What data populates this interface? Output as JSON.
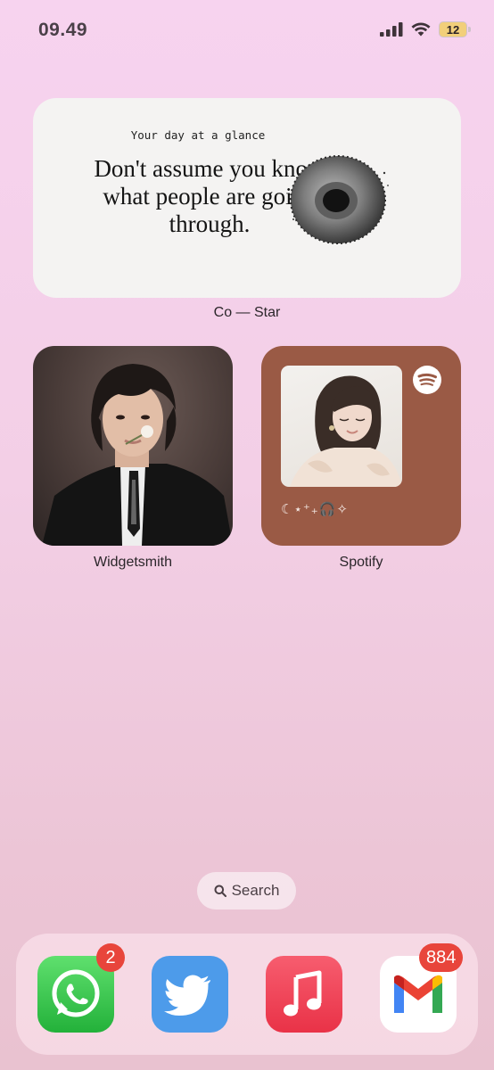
{
  "status_bar": {
    "time": "09.49",
    "battery": "12"
  },
  "costar_widget": {
    "kicker": "Your day at a glance",
    "quote": "Don't assume you know what people are going through.",
    "label": "Co — Star"
  },
  "widgets": {
    "widgetsmith_label": "Widgetsmith",
    "spotify_label": "Spotify",
    "spotify_caption": "☾⋆⁺₊🎧✧"
  },
  "search": {
    "label": "Search"
  },
  "dock": {
    "whatsapp_badge": "2",
    "gmail_badge": "884"
  },
  "colors": {
    "accent_badge": "#e8453b",
    "spotify_widget_bg": "#9a5a45",
    "wallpaper_top": "#f7d3ef"
  }
}
